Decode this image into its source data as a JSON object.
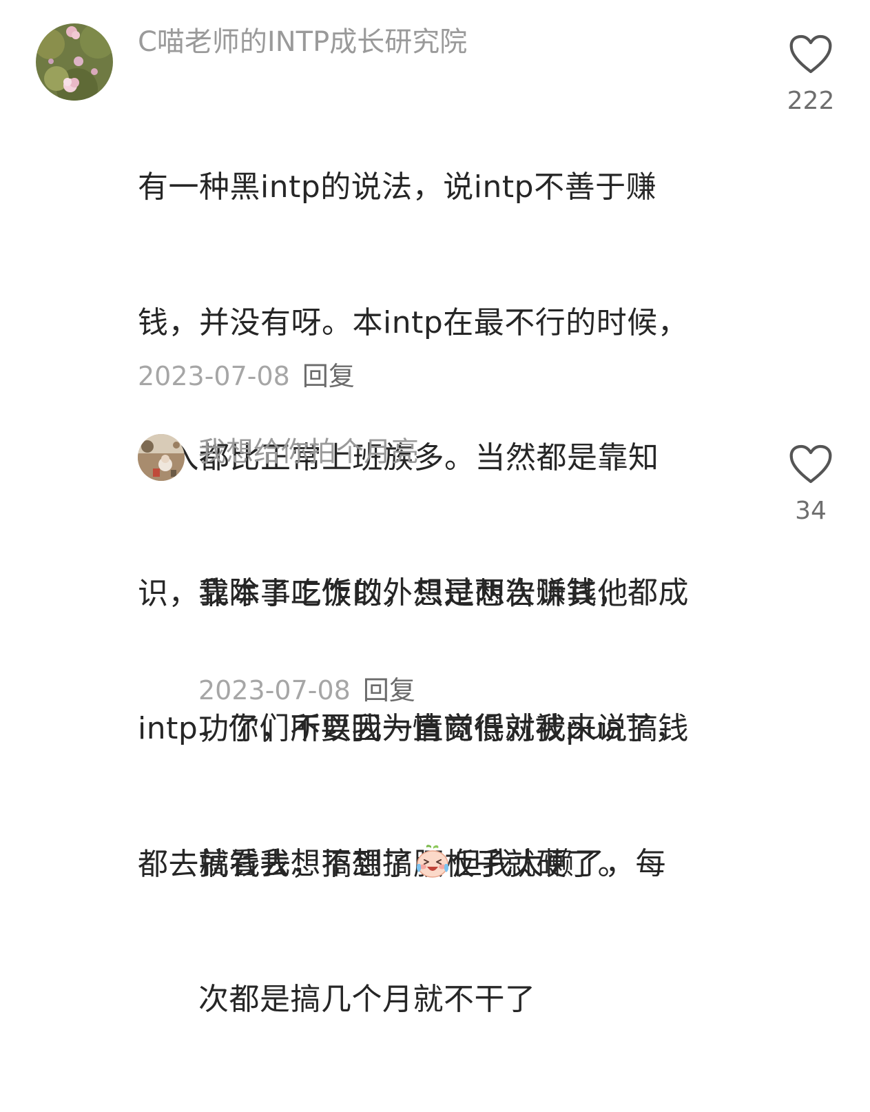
{
  "comments": [
    {
      "username": "C喵老师的INTP成长研究院",
      "content": "有一种黑intp的说法，说intp不善于赚钱，并没有呀。本intp在最不行的时候，收入都比正常上班族多。当然都是靠知识，靠本事吃饭的，只是想告诉其他intp，你们不要因为情商低就被pua了，都去搞钱去，搞到了腰板子就硬了。",
      "content_lines": [
        "有一种黑intp的说法，说intp不善于赚",
        "钱，并没有呀。本intp在最不行的时候，",
        "收入都比正常上班族多。当然都是靠知",
        "识，靠本事吃饭的，只是想告诉其他",
        "intp，你们不要因为情商低就被pua了，",
        "都去搞钱去，搞到了腰板子就硬了。"
      ],
      "date": "2023-07-08",
      "reply_label": "回复",
      "like_count": "222",
      "avatar_icon": "hydrangea-flowers-avatar"
    },
    {
      "username": "我想给你拍个月亮",
      "content_lines": [
        "我除了工作以外想过两次赚钱，都成",
        "功了，所以我一直觉得对我来说搞钱",
        "就看我想不想搞",
        "但我太懒了，每",
        "次都是搞几个月就不干了"
      ],
      "emoji": "crying-laughing-emoji",
      "date": "2023-07-08",
      "reply_label": "回复",
      "like_count": "34",
      "avatar_icon": "outdoor-scene-avatar"
    }
  ],
  "icons": {
    "like": "heart-outline-icon"
  },
  "colors": {
    "username": "#9a9a9a",
    "content": "#262626",
    "date": "#a6a6a6",
    "reply": "#6b6b6b",
    "like_count": "#6e6e6e",
    "heart_stroke": "#555555"
  }
}
